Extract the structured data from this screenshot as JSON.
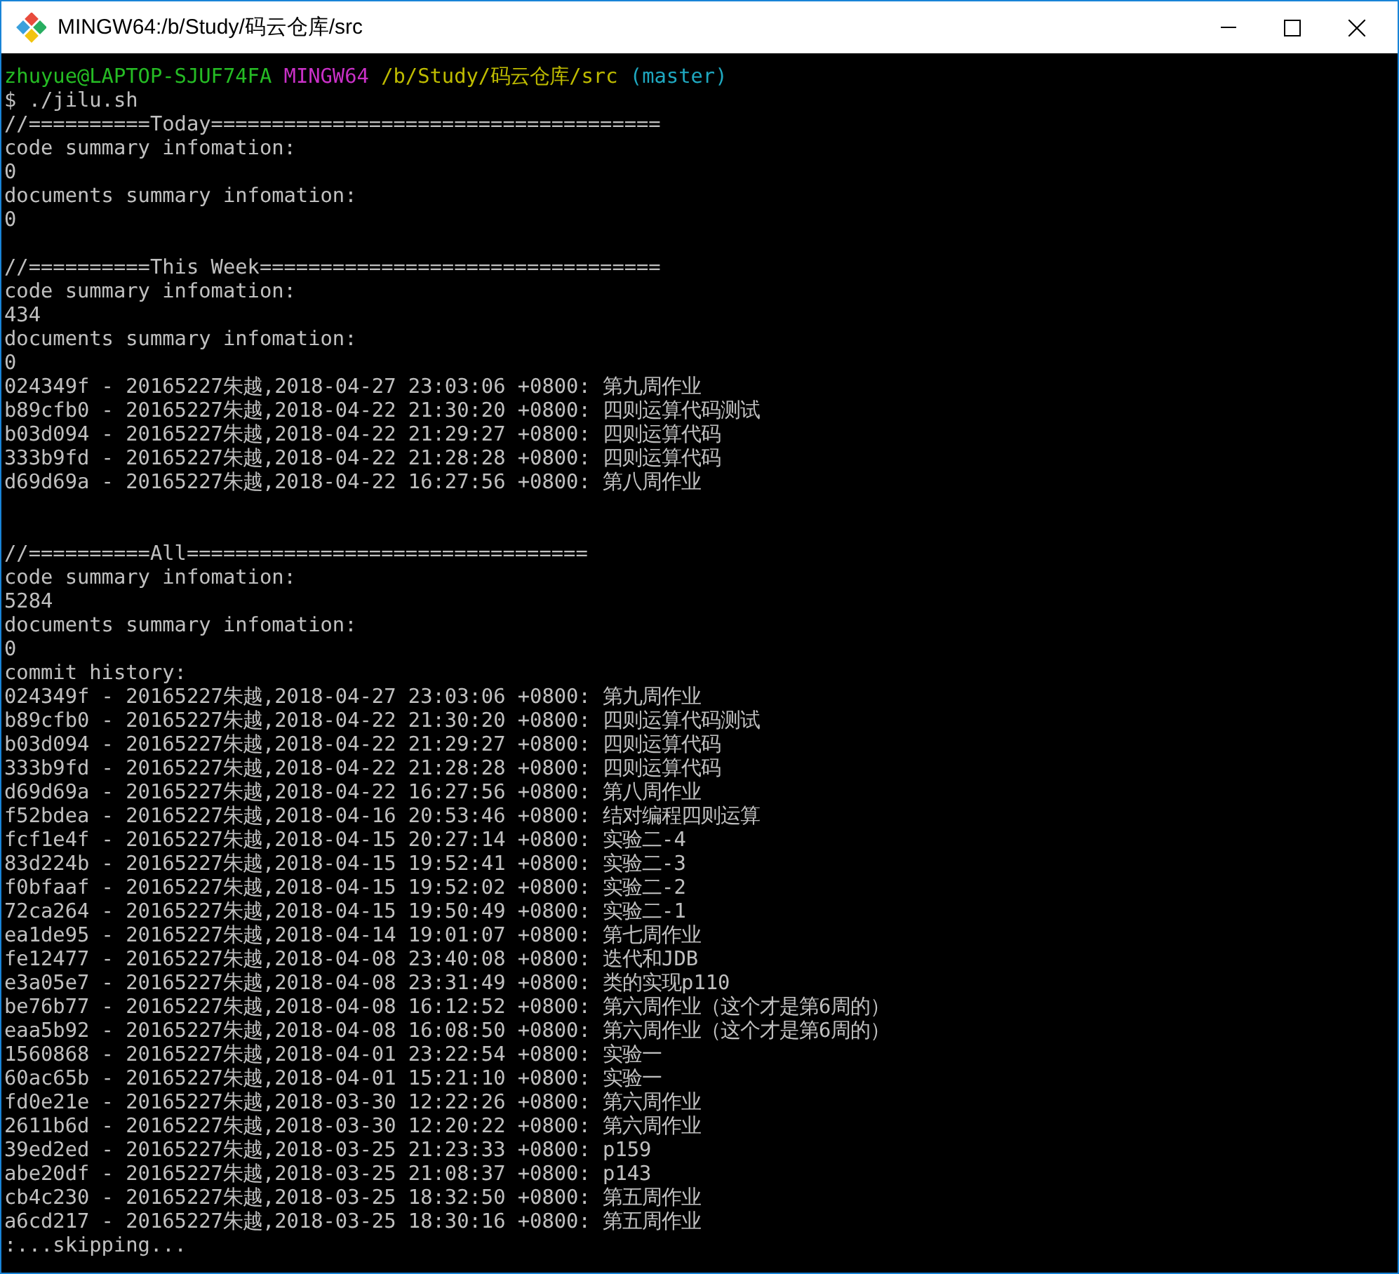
{
  "window": {
    "title": "MINGW64:/b/Study/码云仓库/src"
  },
  "prompt": {
    "user": "zhuyue@LAPTOP-SJUF74FA",
    "system": "MINGW64",
    "path": "/b/Study/码云仓库/src",
    "branch": "(master)"
  },
  "lines": [
    {
      "kind": "output",
      "text": "$ ./jilu.sh"
    },
    {
      "kind": "output",
      "text": "//==========Today====================================="
    },
    {
      "kind": "output",
      "text": "code summary infomation:"
    },
    {
      "kind": "output",
      "text": "0"
    },
    {
      "kind": "output",
      "text": "documents summary infomation:"
    },
    {
      "kind": "output",
      "text": "0"
    },
    {
      "kind": "blank"
    },
    {
      "kind": "output",
      "text": "//==========This Week================================="
    },
    {
      "kind": "output",
      "text": "code summary infomation:"
    },
    {
      "kind": "output",
      "text": "434"
    },
    {
      "kind": "output",
      "text": "documents summary infomation:"
    },
    {
      "kind": "output",
      "text": "0"
    },
    {
      "kind": "output",
      "text": "024349f - 20165227朱越,2018-04-27 23:03:06 +0800: 第九周作业"
    },
    {
      "kind": "output",
      "text": "b89cfb0 - 20165227朱越,2018-04-22 21:30:20 +0800: 四则运算代码测试"
    },
    {
      "kind": "output",
      "text": "b03d094 - 20165227朱越,2018-04-22 21:29:27 +0800: 四则运算代码"
    },
    {
      "kind": "output",
      "text": "333b9fd - 20165227朱越,2018-04-22 21:28:28 +0800: 四则运算代码"
    },
    {
      "kind": "output",
      "text": "d69d69a - 20165227朱越,2018-04-22 16:27:56 +0800: 第八周作业"
    },
    {
      "kind": "blank"
    },
    {
      "kind": "blank"
    },
    {
      "kind": "output",
      "text": "//==========All================================="
    },
    {
      "kind": "output",
      "text": "code summary infomation:"
    },
    {
      "kind": "output",
      "text": "5284"
    },
    {
      "kind": "output",
      "text": "documents summary infomation:"
    },
    {
      "kind": "output",
      "text": "0"
    },
    {
      "kind": "output",
      "text": "commit history:"
    },
    {
      "kind": "output",
      "text": "024349f - 20165227朱越,2018-04-27 23:03:06 +0800: 第九周作业"
    },
    {
      "kind": "output",
      "text": "b89cfb0 - 20165227朱越,2018-04-22 21:30:20 +0800: 四则运算代码测试"
    },
    {
      "kind": "output",
      "text": "b03d094 - 20165227朱越,2018-04-22 21:29:27 +0800: 四则运算代码"
    },
    {
      "kind": "output",
      "text": "333b9fd - 20165227朱越,2018-04-22 21:28:28 +0800: 四则运算代码"
    },
    {
      "kind": "output",
      "text": "d69d69a - 20165227朱越,2018-04-22 16:27:56 +0800: 第八周作业"
    },
    {
      "kind": "output",
      "text": "f52bdea - 20165227朱越,2018-04-16 20:53:46 +0800: 结对编程四则运算"
    },
    {
      "kind": "output",
      "text": "fcf1e4f - 20165227朱越,2018-04-15 20:27:14 +0800: 实验二-4"
    },
    {
      "kind": "output",
      "text": "83d224b - 20165227朱越,2018-04-15 19:52:41 +0800: 实验二-3"
    },
    {
      "kind": "output",
      "text": "f0bfaaf - 20165227朱越,2018-04-15 19:52:02 +0800: 实验二-2"
    },
    {
      "kind": "output",
      "text": "72ca264 - 20165227朱越,2018-04-15 19:50:49 +0800: 实验二-1"
    },
    {
      "kind": "output",
      "text": "ea1de95 - 20165227朱越,2018-04-14 19:01:07 +0800: 第七周作业"
    },
    {
      "kind": "output",
      "text": "fe12477 - 20165227朱越,2018-04-08 23:40:08 +0800: 迭代和JDB"
    },
    {
      "kind": "output",
      "text": "e3a05e7 - 20165227朱越,2018-04-08 23:31:49 +0800: 类的实现p110"
    },
    {
      "kind": "output",
      "text": "be76b77 - 20165227朱越,2018-04-08 16:12:52 +0800: 第六周作业（这个才是第6周的）"
    },
    {
      "kind": "output",
      "text": "eaa5b92 - 20165227朱越,2018-04-08 16:08:50 +0800: 第六周作业（这个才是第6周的）"
    },
    {
      "kind": "output",
      "text": "1560868 - 20165227朱越,2018-04-01 23:22:54 +0800: 实验一"
    },
    {
      "kind": "output",
      "text": "60ac65b - 20165227朱越,2018-04-01 15:21:10 +0800: 实验一"
    },
    {
      "kind": "output",
      "text": "fd0e21e - 20165227朱越,2018-03-30 12:22:26 +0800: 第六周作业"
    },
    {
      "kind": "output",
      "text": "2611b6d - 20165227朱越,2018-03-30 12:20:22 +0800: 第六周作业"
    },
    {
      "kind": "output",
      "text": "39ed2ed - 20165227朱越,2018-03-25 21:23:33 +0800: p159"
    },
    {
      "kind": "output",
      "text": "abe20df - 20165227朱越,2018-03-25 21:08:37 +0800: p143"
    },
    {
      "kind": "output",
      "text": "cb4c230 - 20165227朱越,2018-03-25 18:32:50 +0800: 第五周作业"
    },
    {
      "kind": "output",
      "text": "a6cd217 - 20165227朱越,2018-03-25 18:30:16 +0800: 第五周作业"
    },
    {
      "kind": "output",
      "text": ":...skipping..."
    }
  ]
}
